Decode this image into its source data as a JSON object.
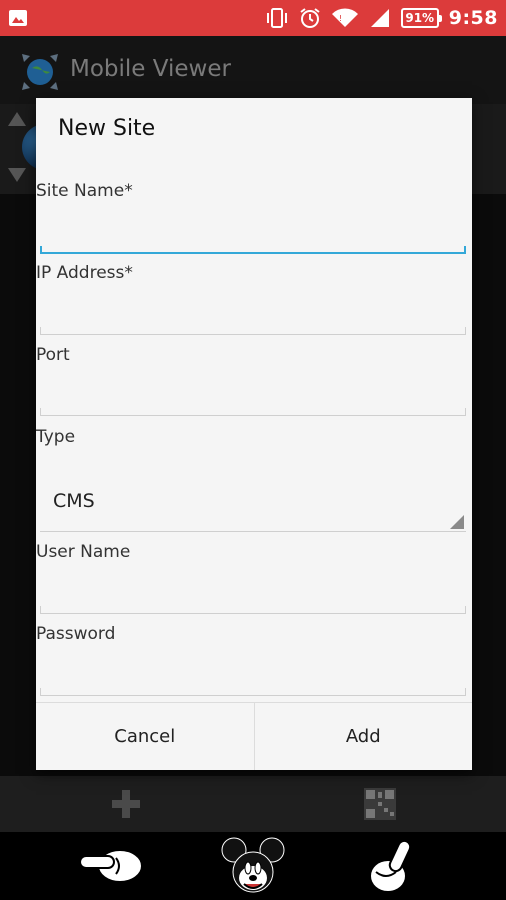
{
  "status_bar": {
    "time": "9:58",
    "battery": "91%",
    "color": "#dc3b3b",
    "icons": [
      "image-icon",
      "vibrate-icon",
      "alarm-icon",
      "wifi-icon",
      "signal-icon",
      "battery-icon"
    ]
  },
  "app_bar": {
    "title": "Mobile Viewer",
    "logo_icon": "globe-icon"
  },
  "dialog": {
    "title": "New Site",
    "fields": {
      "site_name": {
        "label": "Site Name*",
        "value": ""
      },
      "ip_address": {
        "label": "IP Address*",
        "value": ""
      },
      "port": {
        "label": "Port",
        "value": ""
      },
      "type": {
        "label": "Type",
        "value": "CMS"
      },
      "user_name": {
        "label": "User Name",
        "value": ""
      },
      "password": {
        "label": "Password",
        "value": ""
      }
    },
    "buttons": {
      "cancel": "Cancel",
      "add": "Add"
    },
    "accent": "#33a8d8"
  },
  "bottom_bar": {
    "icons": [
      "plus-icon",
      "qr-code-icon"
    ]
  },
  "mascot_bar": {
    "icons": [
      "pointing-left-hand-icon",
      "mouse-mascot-icon",
      "pointing-up-hand-icon"
    ]
  }
}
